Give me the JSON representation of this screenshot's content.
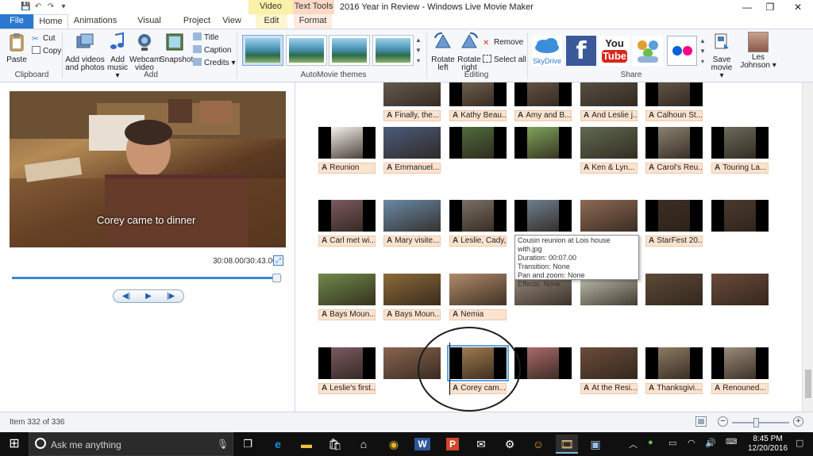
{
  "window": {
    "title": "2016 Year in Review - Windows Live Movie Maker",
    "minimize": "—",
    "restore": "❐",
    "close": "✕"
  },
  "quick_access": [
    "💾",
    "↶",
    "↷",
    "▾"
  ],
  "context_tabs": {
    "video_tools": "Video Tools",
    "text_tools": "Text Tools"
  },
  "tabs": {
    "file": "File",
    "home": "Home",
    "animations": "Animations",
    "visual_effects": "Visual Effects",
    "project": "Project",
    "view": "View",
    "edit": "Edit",
    "format": "Format"
  },
  "ribbon": {
    "clipboard": {
      "label": "Clipboard",
      "paste": "Paste",
      "cut": "Cut",
      "copy": "Copy"
    },
    "add": {
      "label": "Add",
      "add_videos_1": "Add videos",
      "add_videos_2": "and photos",
      "add_music_1": "Add",
      "add_music_2": "music ▾",
      "webcam_1": "Webcam",
      "webcam_2": "video",
      "snapshot": "Snapshot",
      "title": "Title",
      "caption": "Caption",
      "credits": "Credits ▾"
    },
    "themes": {
      "label": "AutoMovie themes"
    },
    "editing": {
      "label": "Editing",
      "rotate_left_1": "Rotate",
      "rotate_left_2": "left",
      "rotate_right_1": "Rotate",
      "rotate_right_2": "right",
      "remove": "Remove",
      "select_all": "Select all"
    },
    "share": {
      "label": "Share",
      "skydrive": "SkyDrive",
      "youtube_1": "You",
      "youtube_2": "Tube",
      "save_movie_1": "Save",
      "save_movie_2": "movie ▾",
      "user_1": "Les",
      "user_2": "Johnson ▾"
    }
  },
  "preview": {
    "caption": "Corey came to dinner",
    "time": "30:08.00/30:43.00",
    "seek_fraction": 0.98,
    "prev_label": "◀|",
    "play_label": "▶",
    "next_label": "|▶"
  },
  "storyboard": {
    "caption_marker": "A",
    "rows": [
      {
        "clips": [
          {
            "caption": "",
            "hide": true
          },
          {
            "caption": "Finally, the...",
            "tone": "#6c6256"
          },
          {
            "caption": "Kathy Beau...",
            "tone": "#7a6a55"
          },
          {
            "caption": "Amy and B...",
            "tone": "#6e5a4a"
          },
          {
            "caption": "And Leslie j...",
            "tone": "#5d5548"
          },
          {
            "caption": "Calhoun St...",
            "tone": "#6b5c4f"
          }
        ]
      },
      {
        "clips": [
          {
            "caption": "Reunion",
            "tone": "#f4f0ea"
          },
          {
            "caption": "Emmanuel...",
            "tone": "#4b5b7a"
          },
          {
            "caption": "",
            "tone": "#4f6b3b"
          },
          {
            "caption": "",
            "tone": "#7ea35a"
          },
          {
            "caption": "Ken & Lyn...",
            "tone": "#5f6a52"
          },
          {
            "caption": "Carol's Reu...",
            "tone": "#8a8070"
          },
          {
            "caption": "Touring La...",
            "tone": "#6a6a5a"
          }
        ]
      },
      {
        "clips": [
          {
            "caption": "Carl met wi...",
            "tone": "#7b5a5e"
          },
          {
            "caption": "Mary visite...",
            "tone": "#6a8aa6"
          },
          {
            "caption": "Leslie, Cady,",
            "tone": "#7a7064"
          },
          {
            "caption": "",
            "tone": "#6e7f8e"
          },
          {
            "caption": "",
            "tone": "#8e6a56"
          },
          {
            "caption": "StarFest 20...",
            "tone": "#3c2e24"
          },
          {
            "caption": "",
            "tone": "#4a3a2e"
          }
        ]
      },
      {
        "clips": [
          {
            "caption": "Bays Moun...",
            "tone": "#6f8a4a"
          },
          {
            "caption": "Bays Moun...",
            "tone": "#8b6a3a"
          },
          {
            "caption": "Nemia",
            "tone": "#b08a6a"
          },
          {
            "caption": "",
            "tone": "#9a8d80"
          },
          {
            "caption": "",
            "tone": "#c4c6b4"
          },
          {
            "caption": "",
            "tone": "#5d4a38"
          },
          {
            "caption": "",
            "tone": "#6a4a3a"
          }
        ]
      },
      {
        "clips": [
          {
            "caption": "Leslie's first...",
            "tone": "#7a5a62"
          },
          {
            "caption": "",
            "tone": "#8a6450"
          },
          {
            "caption": "Corey cam...",
            "tone": "#a07a4e",
            "selected": true
          },
          {
            "caption": "",
            "tone": "#a86a6a"
          },
          {
            "caption": "At the Resi...",
            "tone": "#6a4c3a"
          },
          {
            "caption": "Thanksgivi...",
            "tone": "#8a7a62"
          },
          {
            "caption": "Renouned...",
            "tone": "#9a8a7a"
          }
        ]
      }
    ]
  },
  "tooltip": {
    "name": "Cousin reunion at Lois house with.jpg",
    "duration": "Duration: 00:07.00",
    "transition": "Transition: None",
    "pan_zoom": "Pan and zoom: None",
    "effects": "Effects: None"
  },
  "status": {
    "item": "Item 332 of 336",
    "zoom_fraction": 0.42
  },
  "taskbar": {
    "search_placeholder": "Ask me anything",
    "time": "8:45 PM",
    "date": "12/20/2016"
  },
  "colors": {
    "accent": "#2b79d0",
    "caption_bg": "#fbe3cf",
    "video_tools": "#fdf0a8",
    "text_tools": "#fbd9c5"
  }
}
